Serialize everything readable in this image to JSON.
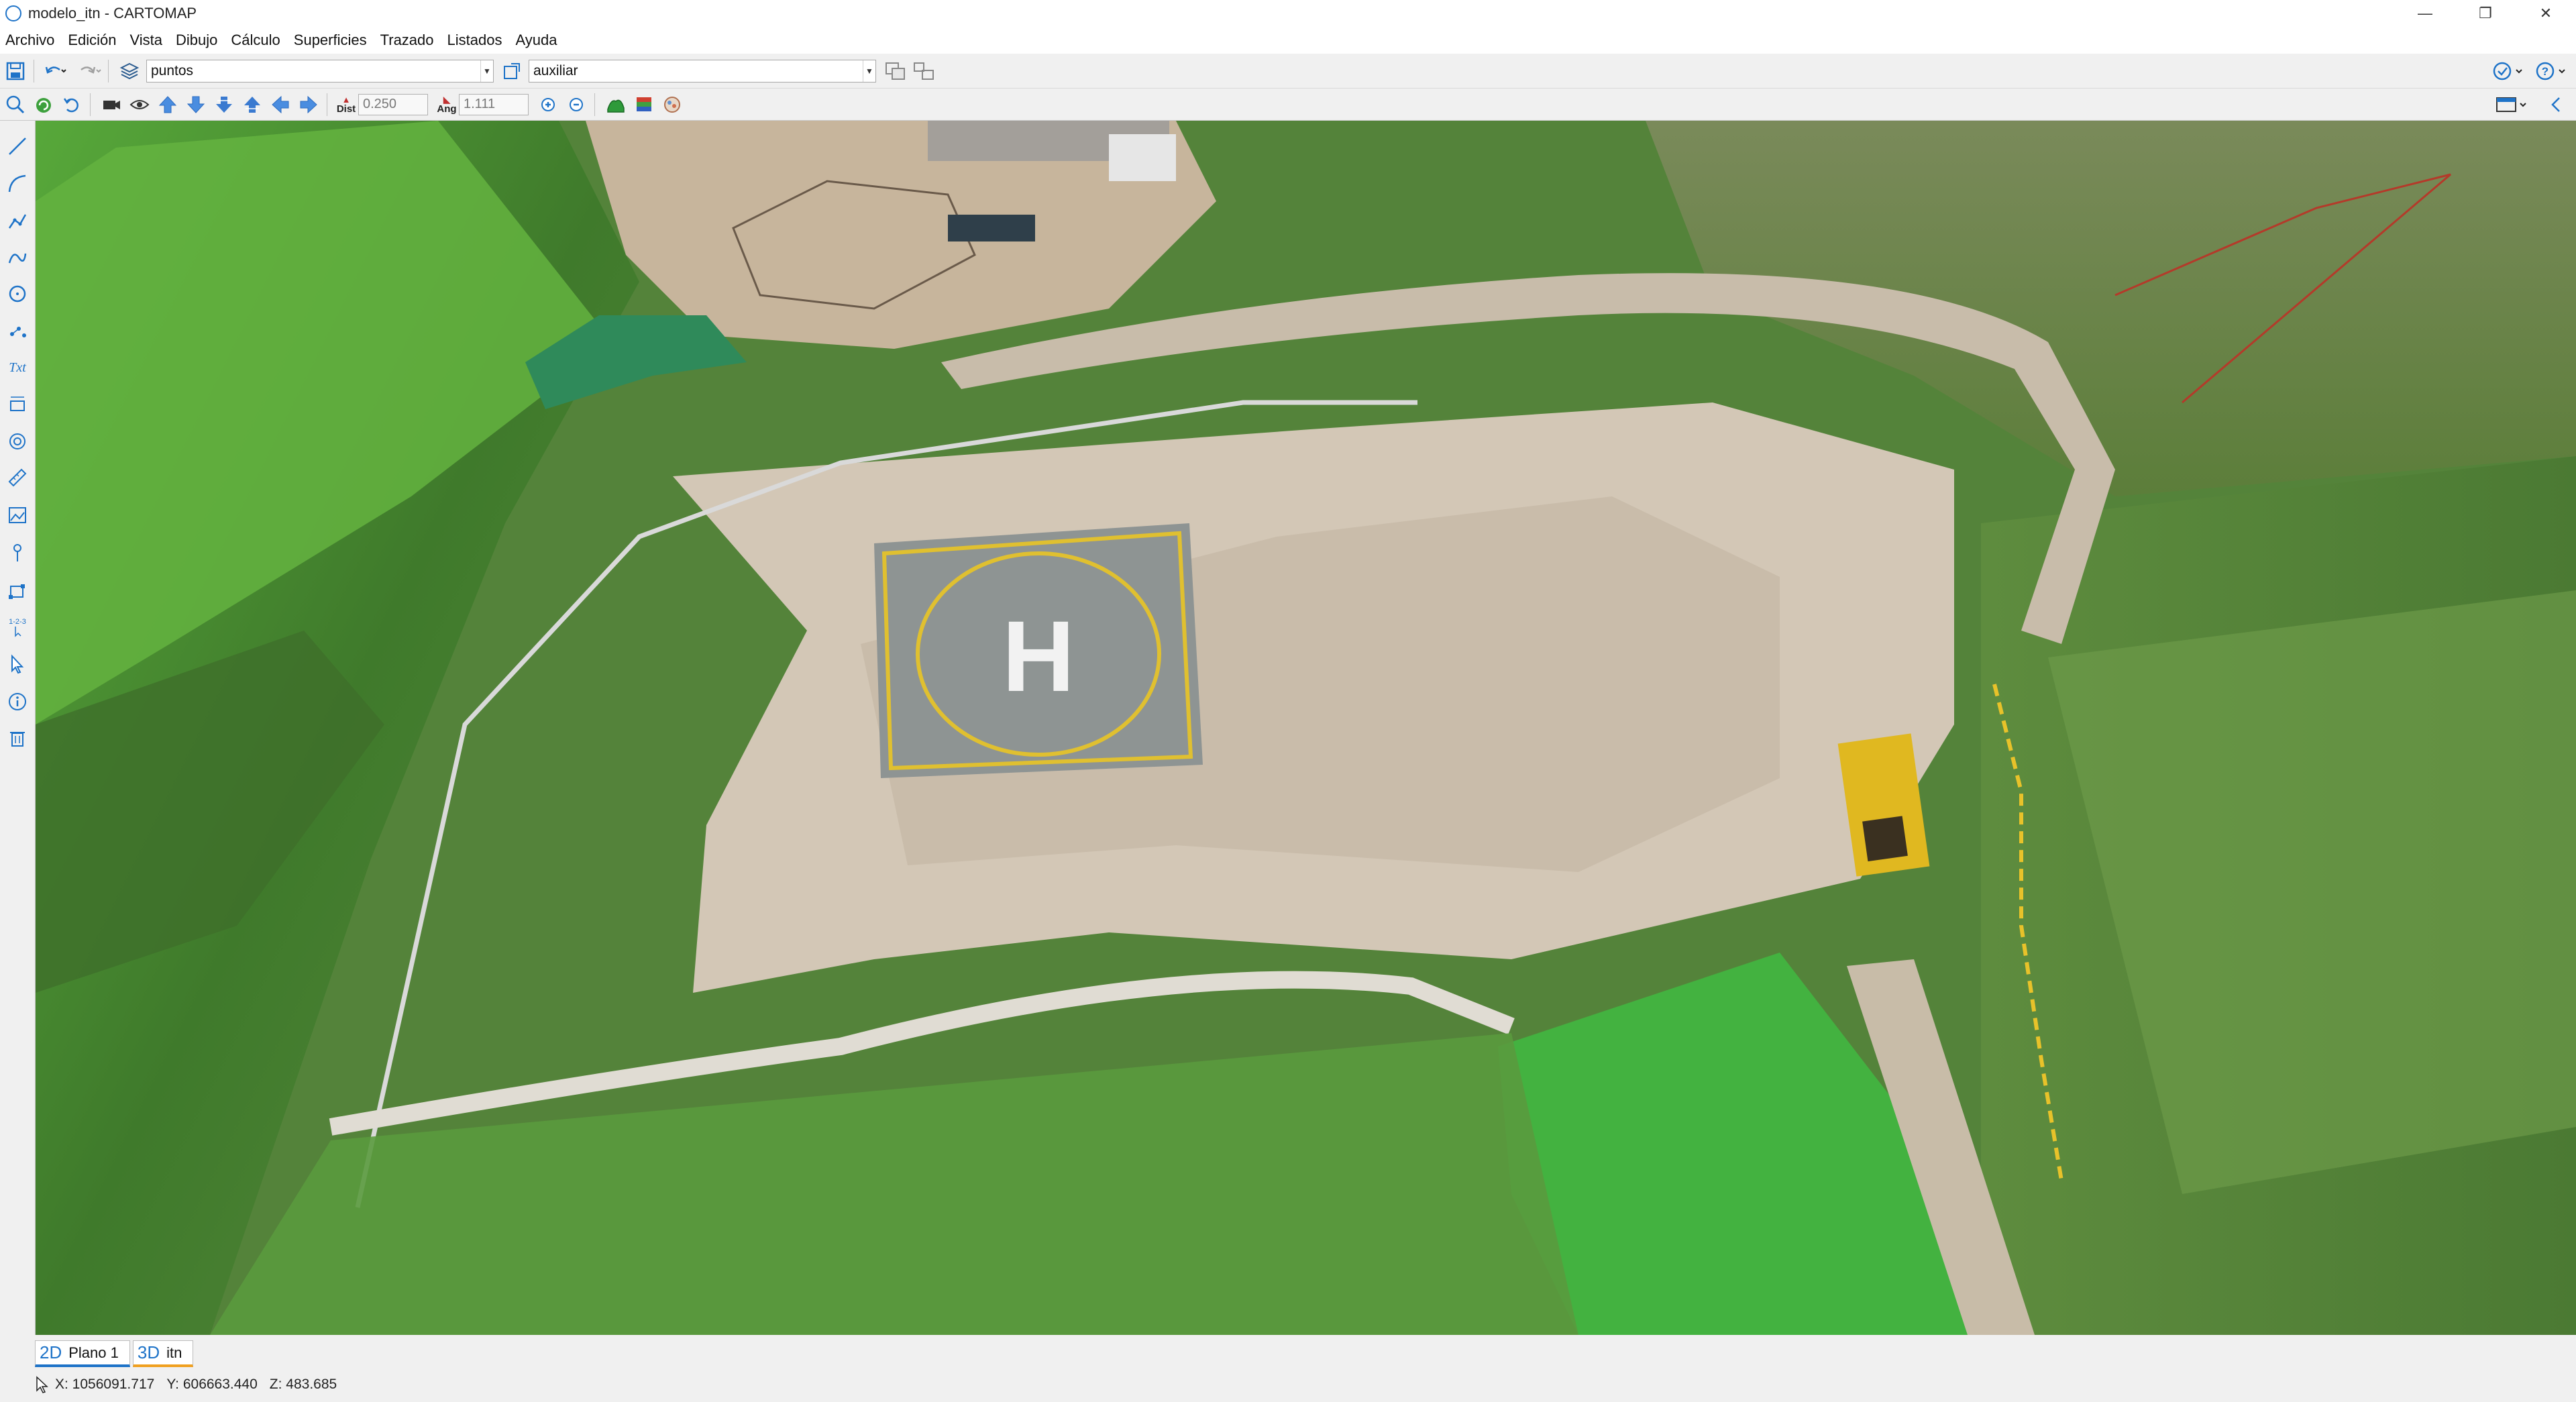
{
  "window": {
    "title": "modelo_itn - CARTOMAP",
    "controls": {
      "minimize": "—",
      "restore": "❐",
      "close": "✕"
    }
  },
  "menu": [
    "Archivo",
    "Edición",
    "Vista",
    "Dibujo",
    "Cálculo",
    "Superficies",
    "Trazado",
    "Listados",
    "Ayuda"
  ],
  "toolbar": {
    "layer_combo": "puntos",
    "aux_combo": "auxiliar",
    "dist_label": "Dist",
    "dist_value": "0.250",
    "ang_label": "Ang",
    "ang_value": "1.111"
  },
  "tabs": [
    {
      "kind": "2D",
      "label": "Plano 1"
    },
    {
      "kind": "3D",
      "label": "itn"
    }
  ],
  "status": {
    "x": "X: 1056091.717",
    "y": "Y: 606663.440",
    "z": "Z: 483.685"
  },
  "colors": {
    "accent": "#1e73c8",
    "grass": "#4f8a2e",
    "dirt": "#c9bcaa",
    "helipad_line": "#e0c030"
  }
}
